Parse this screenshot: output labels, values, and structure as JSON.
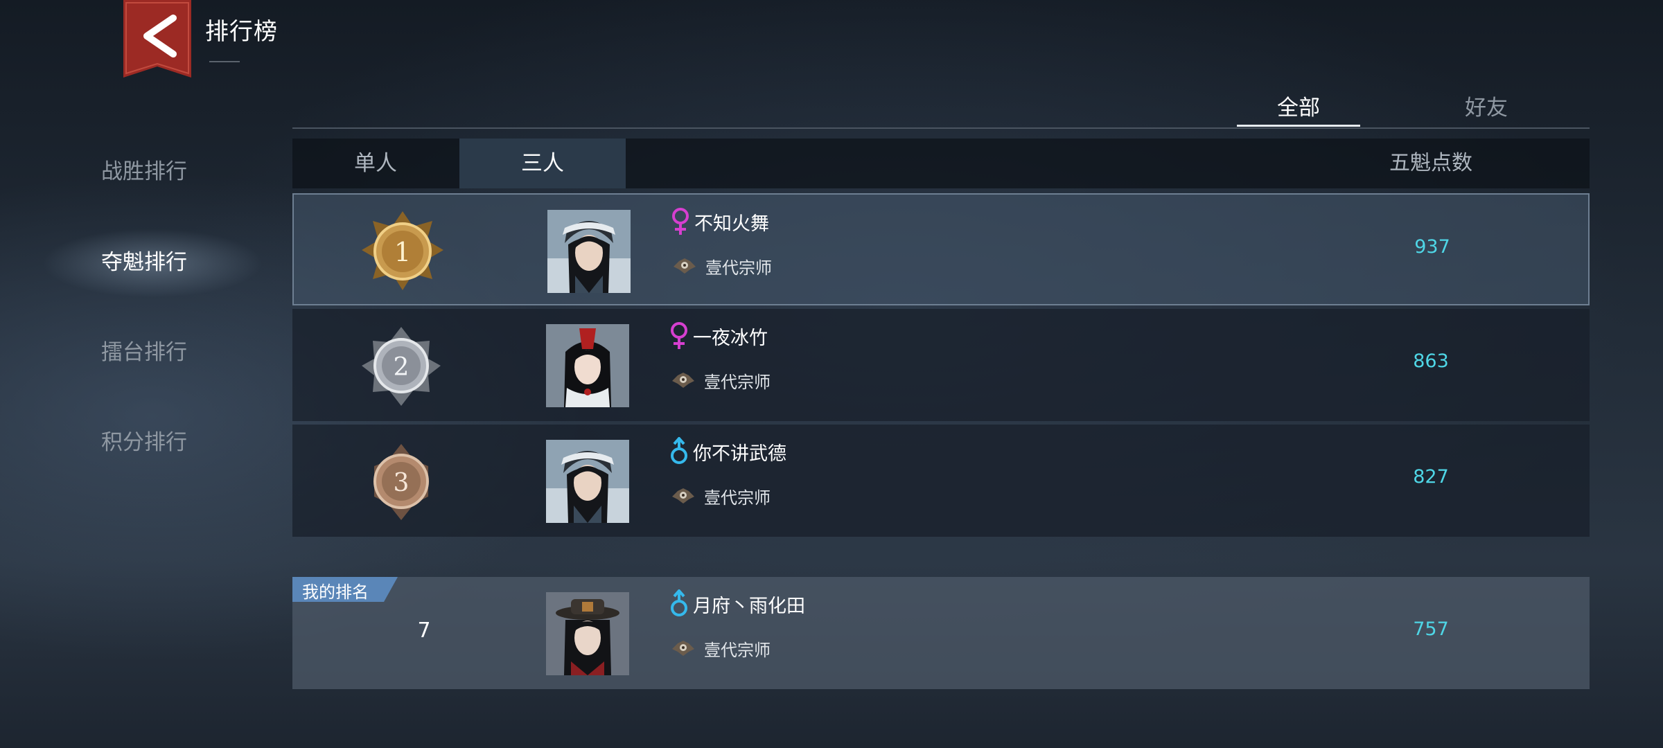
{
  "header": {
    "title": "排行榜",
    "back_icon": "back-arrow-icon"
  },
  "sidebar": {
    "items": [
      {
        "label": "战胜排行",
        "active": false
      },
      {
        "label": "夺魁排行",
        "active": true
      },
      {
        "label": "擂台排行",
        "active": false
      },
      {
        "label": "积分排行",
        "active": false
      }
    ]
  },
  "top_tabs": [
    {
      "label": "全部",
      "active": true
    },
    {
      "label": "好友",
      "active": false
    }
  ],
  "mode_tabs": [
    {
      "label": "单人",
      "active": false
    },
    {
      "label": "三人",
      "active": true
    }
  ],
  "column_header": {
    "score": "五魁点数"
  },
  "rows": [
    {
      "rank": "1",
      "gender": "female",
      "name": "不知火舞",
      "guild": "壹代宗师",
      "score": "937"
    },
    {
      "rank": "2",
      "gender": "female",
      "name": "一夜冰竹",
      "guild": "壹代宗师",
      "score": "863"
    },
    {
      "rank": "3",
      "gender": "male",
      "name": "你不讲武德",
      "guild": "壹代宗师",
      "score": "827"
    }
  ],
  "my_rank": {
    "tag": "我的排名",
    "rank": "7",
    "gender": "male",
    "name": "月府丶雨化田",
    "guild": "壹代宗师",
    "score": "757"
  },
  "colors": {
    "score": "#4fd6e6",
    "female": "#d63fd0",
    "male": "#35b9ec",
    "gold": "#c89a4e",
    "silver": "#aeb3bb",
    "bronze": "#b48a6e"
  }
}
